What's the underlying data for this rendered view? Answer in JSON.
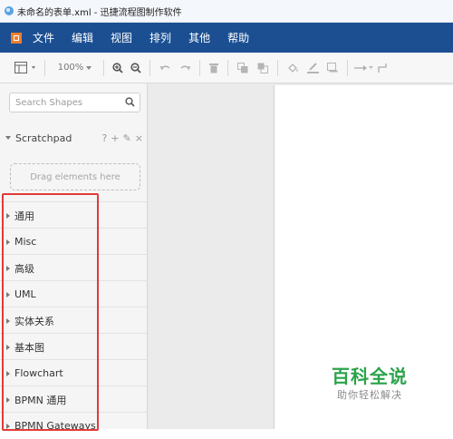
{
  "window": {
    "title": "未命名的表单.xml - 迅捷流程图制作软件"
  },
  "menu": {
    "items": [
      "文件",
      "编辑",
      "视图",
      "排列",
      "其他",
      "帮助"
    ]
  },
  "toolbar": {
    "zoom": "100%"
  },
  "sidebar": {
    "search_placeholder": "Search Shapes",
    "scratchpad": {
      "label": "Scratchpad",
      "tools": [
        "?",
        "+",
        "✎",
        "×"
      ]
    },
    "drag_hint": "Drag elements here",
    "categories": [
      "通用",
      "Misc",
      "高级",
      "UML",
      "实体关系",
      "基本图",
      "Flowchart",
      "BPMN 通用",
      "BPMN Gateways"
    ]
  },
  "watermark": {
    "title": "百科全说",
    "subtitle": "助你轻松解决"
  },
  "colors": {
    "menubar": "#1b4f92",
    "logo": "#f07f2a",
    "highlight": "#e23a3a",
    "watermark": "#2aa34a"
  }
}
